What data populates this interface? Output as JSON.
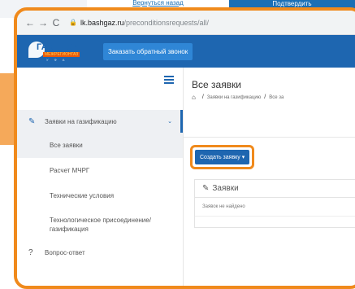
{
  "background": {
    "top_link": "Вернуться назад",
    "top_button": "Подтвердить"
  },
  "browser": {
    "back_icon": "arrow-left-icon",
    "forward_icon": "arrow-right-icon",
    "reload_icon": "reload-icon",
    "url_domain": "lk.bashgaz.ru",
    "url_path": "/preconditionsrequests/all/"
  },
  "header": {
    "logo_title": "ГАЗПРОМ",
    "logo_sub": "МЕЖРЕГИОНГАЗ",
    "logo_sub2": "У Ф А",
    "callback_button": "Заказать обратный звонок"
  },
  "sidebar": {
    "group_label": "Заявки на газификацию",
    "items": [
      {
        "label": "Все заявки"
      },
      {
        "label": "Расчет МЧРГ"
      },
      {
        "label": "Технические условия"
      },
      {
        "label": "Технологическое присоединение/газификация"
      }
    ],
    "faq_label": "Вопрос-ответ"
  },
  "main": {
    "page_title": "Все заявки",
    "breadcrumb_1": "Заявки на газификацию",
    "breadcrumb_2": "Все за",
    "create_button": "Создать заявку ▾",
    "panel_title": "Заявки",
    "empty_text": "Заявок не найдено"
  },
  "colors": {
    "accent_orange": "#f08a1c",
    "brand_blue": "#1e66b0"
  }
}
